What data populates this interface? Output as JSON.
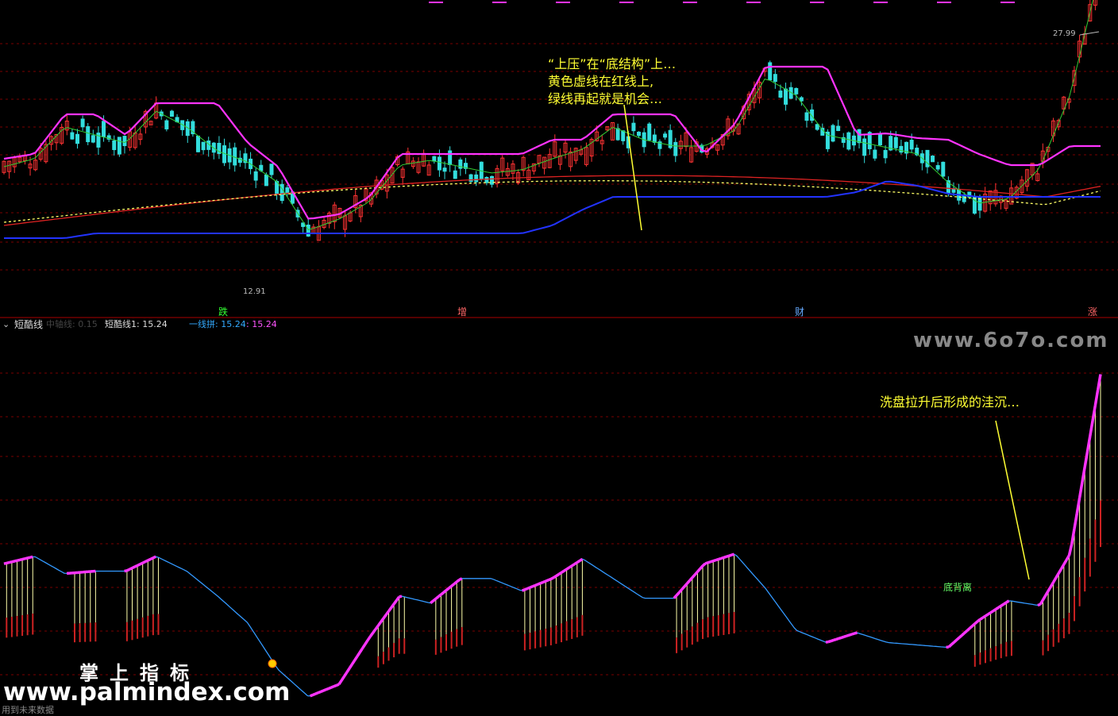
{
  "colors": {
    "background": "#000000",
    "grid": "#7a0000",
    "candle_up": "#ff3333",
    "candle_down": "#33dddd",
    "upper_band": "#ff33ff",
    "green_line": "#33cc33",
    "red_ma": "#dd2222",
    "dashed_ma": "#ffff66",
    "blue_support": "#2233ff",
    "oscillator_line": "#3399ff",
    "oscillator_highlight": "#ff33ff",
    "bar_red": "#cc2222",
    "bar_yellow": "#ffffaa",
    "annotation": "#ffff33"
  },
  "main_panel": {
    "price_high_label": "27.99",
    "price_low_label": "12.91",
    "annotation_top": [
      "“上压”在“底结构”上…",
      "黄色虚线在红线上,",
      "绿线再起就是机会…"
    ],
    "markers": [
      {
        "text": "跌",
        "color": "#33ff33"
      },
      {
        "text": "增",
        "color": "#ff6666"
      },
      {
        "text": "财",
        "color": "#66aaff"
      },
      {
        "text": "涨",
        "color": "#ff6666"
      }
    ]
  },
  "sub_panel": {
    "header": {
      "collapse_icon": "chevron-down-icon",
      "name": "短酷线",
      "faded_text": "中轴线: 0.15",
      "value1": "短酷线1: 15.24",
      "value2_label": "一线拼: 15.24",
      "value2_extra": ": 15.24"
    },
    "annotation_bottom": "洗盘拉升后形成的洼沉…",
    "label_divergence": "底背离",
    "watermark_site": "www.6o7o.com",
    "watermark_cn": "掌上指标",
    "watermark_url": "www.palmindex.com",
    "footer_note": "用到未来数据"
  },
  "chart_data": [
    {
      "type": "candlestick",
      "title": "",
      "series": [
        {
          "name": "upper_band",
          "values": [
            21,
            21.3,
            23.8,
            23.8,
            22.5,
            24.5,
            24.5,
            24.5,
            22,
            20.5,
            17.2,
            17.5,
            18.6,
            21.3,
            21.3,
            21.3,
            21.3,
            21.3,
            22.2,
            22.2,
            23.8,
            23.8,
            23.8,
            21.3,
            23.2,
            26.8,
            26.8,
            26.8,
            22.5,
            22.6,
            22.3,
            22.2,
            21.3,
            20.6,
            20.6,
            21.8,
            21.8
          ]
        },
        {
          "name": "green_line",
          "values": [
            20.5,
            21,
            23,
            22.5,
            22,
            24,
            23,
            21.5,
            20.8,
            19.5,
            16.5,
            17.2,
            18.3,
            20.6,
            20.9,
            20.5,
            20.1,
            20.3,
            21,
            21.6,
            23,
            22.2,
            21.8,
            21.8,
            22.8,
            26.1,
            25,
            22.5,
            22.1,
            21.7,
            21.3,
            19.5,
            18.2,
            18.5,
            20.4,
            25,
            33
          ]
        },
        {
          "name": "blue_support",
          "values": [
            16,
            16,
            16,
            16.3,
            16.3,
            16.3,
            16.3,
            16.3,
            16.3,
            16.3,
            16.3,
            16.3,
            16.3,
            16.3,
            16.3,
            16.3,
            16.3,
            16.3,
            16.8,
            17.8,
            18.6,
            18.6,
            18.6,
            18.6,
            18.6,
            18.6,
            18.6,
            18.6,
            18.9,
            19.6,
            19.3,
            18.8,
            18.6,
            18.6,
            18.6,
            18.6,
            18.6
          ]
        }
      ]
    },
    {
      "type": "line",
      "title": "",
      "series": [
        {
          "name": "oscillator",
          "values": [
            5.8,
            6.1,
            5.4,
            5.5,
            5.5,
            6.1,
            5.5,
            4.5,
            3.4,
            1.5,
            0.4,
            0.9,
            2.8,
            4.5,
            4.2,
            5.2,
            5.2,
            4.7,
            5.2,
            6,
            5.2,
            4.4,
            4.4,
            5.8,
            6.2,
            4.8,
            3.1,
            2.6,
            3,
            2.6,
            2.5,
            2.4,
            3.5,
            4.3,
            4.1,
            6.2,
            13.5
          ]
        }
      ]
    }
  ]
}
